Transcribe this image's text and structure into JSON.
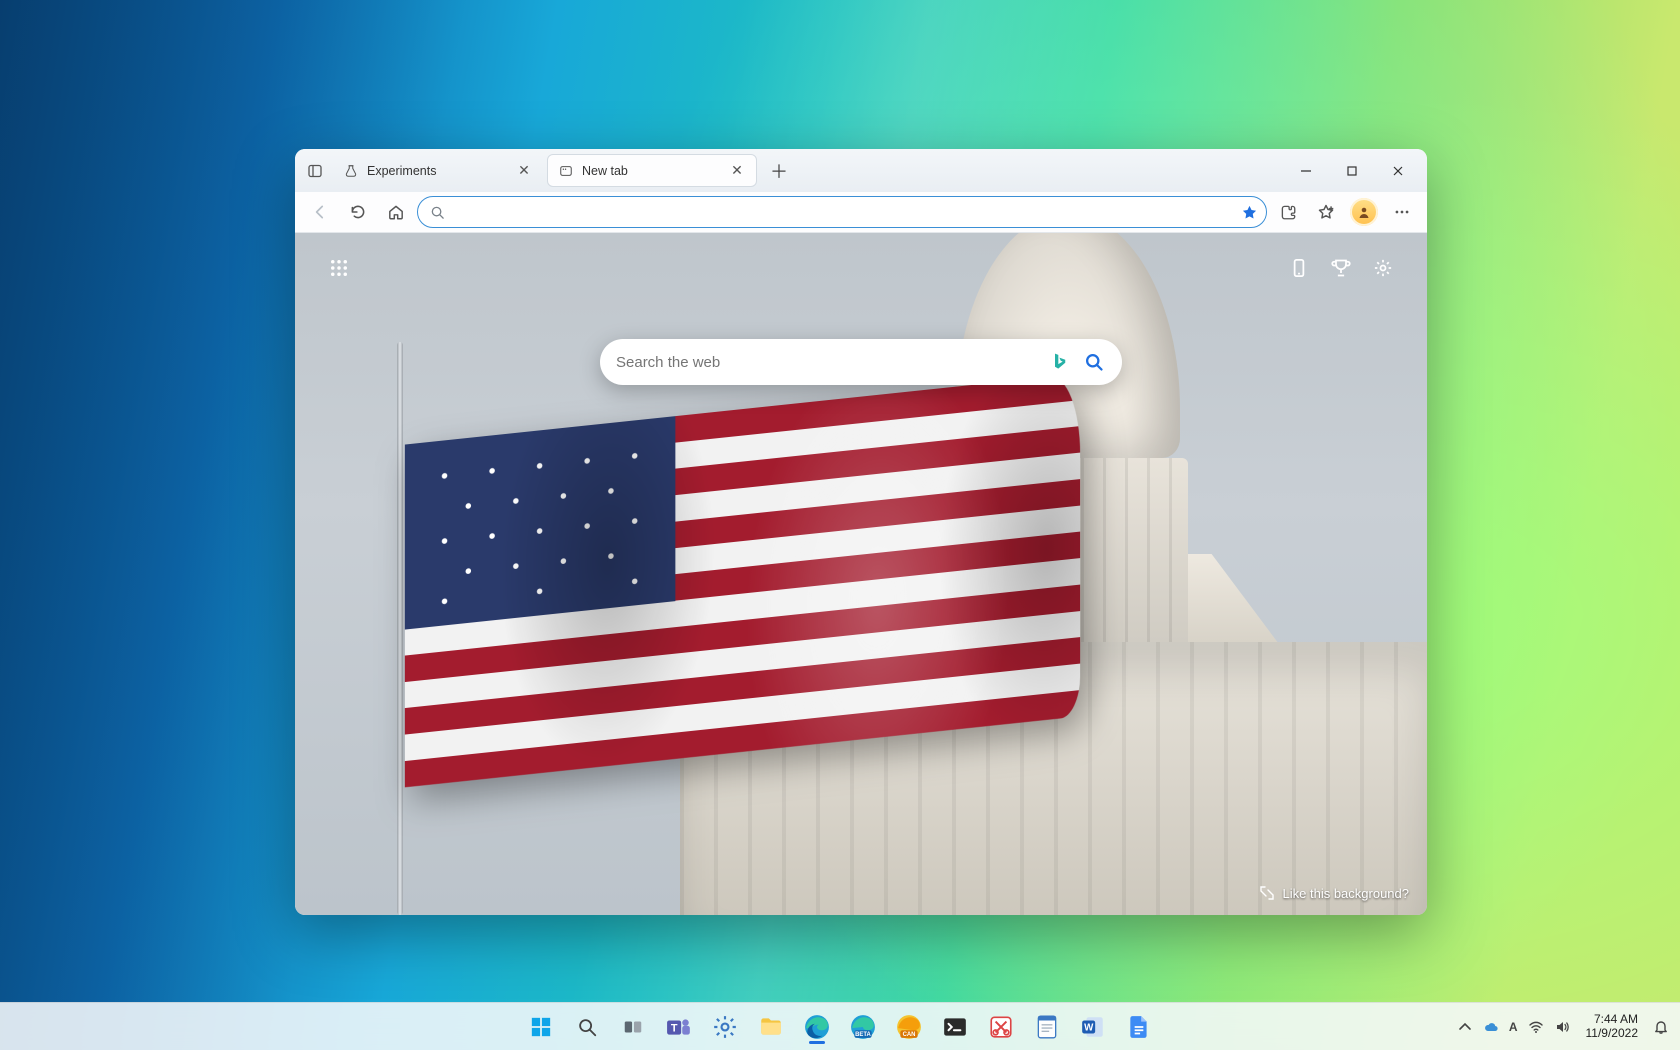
{
  "browser": {
    "tabs": [
      {
        "title": "Experiments",
        "favicon": "flask-icon",
        "active": false
      },
      {
        "title": "New tab",
        "favicon": "newtab-icon",
        "active": true
      }
    ],
    "addressbar": {
      "value": "",
      "placeholder": ""
    },
    "toolbar_icons": {
      "back": "back-icon",
      "forward": "forward-icon",
      "refresh": "refresh-icon",
      "home": "home-icon",
      "extensions": "puzzle-icon",
      "favorites": "star-outline-icon",
      "more": "ellipsis-icon"
    }
  },
  "newtab": {
    "search_placeholder": "Search the web",
    "like_background_label": "Like this background?"
  },
  "taskbar": {
    "apps": [
      {
        "name": "start",
        "icon": "windows-icon"
      },
      {
        "name": "search",
        "icon": "search-icon"
      },
      {
        "name": "task-view",
        "icon": "taskview-icon"
      },
      {
        "name": "teams",
        "icon": "teams-icon"
      },
      {
        "name": "settings",
        "icon": "gear-icon"
      },
      {
        "name": "file-explorer",
        "icon": "folder-icon"
      },
      {
        "name": "edge",
        "icon": "edge-icon",
        "active": true
      },
      {
        "name": "edge-beta",
        "icon": "edge-beta-icon"
      },
      {
        "name": "edge-canary",
        "icon": "edge-canary-icon"
      },
      {
        "name": "terminal",
        "icon": "terminal-icon"
      },
      {
        "name": "snipping-tool",
        "icon": "snip-icon"
      },
      {
        "name": "notepad",
        "icon": "notepad-icon"
      },
      {
        "name": "word",
        "icon": "word-icon"
      },
      {
        "name": "docs",
        "icon": "docs-icon"
      }
    ]
  },
  "tray": {
    "time": "7:44 AM",
    "date": "11/9/2022"
  }
}
